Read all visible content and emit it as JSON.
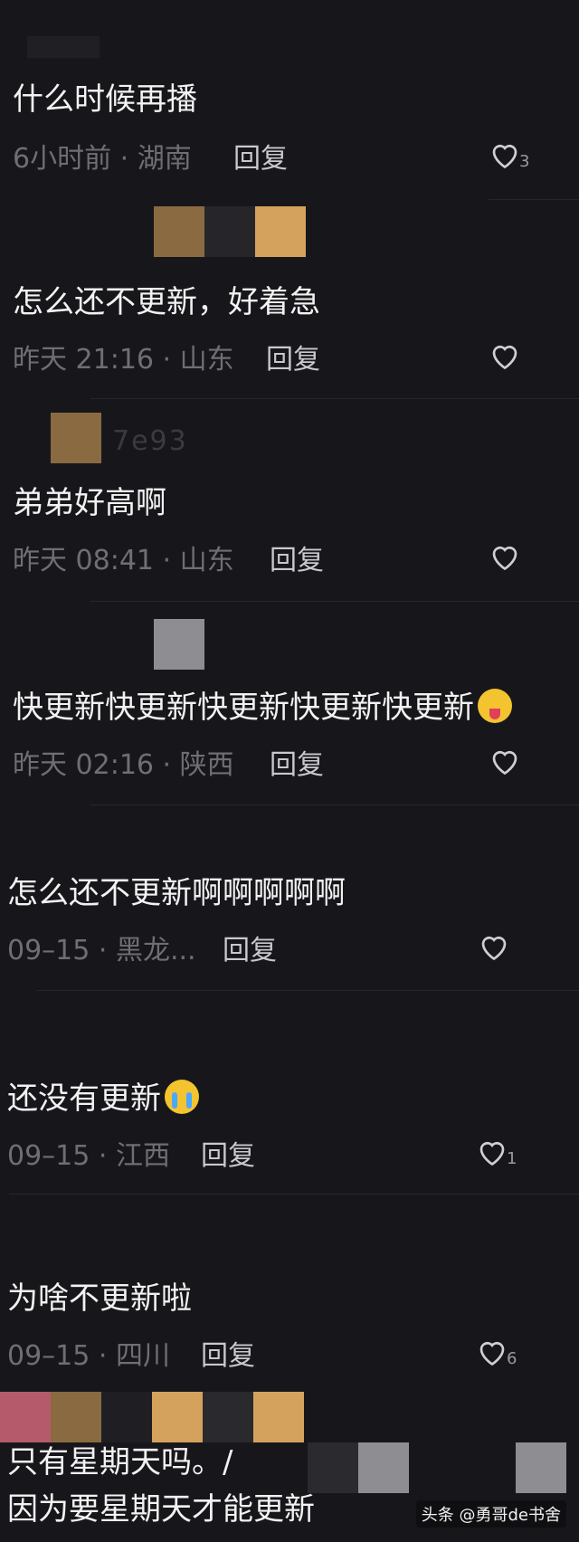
{
  "comments": [
    {
      "text": "什么时候再播",
      "time": "6小时前",
      "location": "湖南",
      "reply": "回复",
      "likes": "3"
    },
    {
      "text": "怎么还不更新，好着急",
      "time": "昨天 21:16",
      "location": "山东",
      "reply": "回复",
      "likes": ""
    },
    {
      "text": "弟弟好高啊",
      "time": "昨天 08:41",
      "location": "山东",
      "reply": "回复",
      "likes": ""
    },
    {
      "text": "快更新快更新快更新快更新快更新",
      "time": "昨天 02:16",
      "location": "陕西",
      "reply": "回复",
      "likes": ""
    },
    {
      "text": "怎么还不更新啊啊啊啊啊",
      "time": "09–15",
      "location": "黑龙...",
      "reply": "回复",
      "likes": ""
    },
    {
      "text": "还没有更新",
      "time": "09–15",
      "location": "江西",
      "reply": "回复",
      "likes": "1"
    },
    {
      "text": "为啥不更新啦",
      "time": "09–15",
      "location": "四川",
      "reply": "回复",
      "likes": "6"
    }
  ],
  "last_comment": {
    "line1": "只有星期天吗。/",
    "line2": "因为要星期天才能更新"
  },
  "separator": " · ",
  "blurred_name": "7e93",
  "watermark": "头条 @勇哥de书舍",
  "icons": {
    "like": "heart-outline-icon"
  },
  "colors": {
    "background": "#17171b",
    "meta": "#6e6e74",
    "reply": "#c9c9cd"
  }
}
